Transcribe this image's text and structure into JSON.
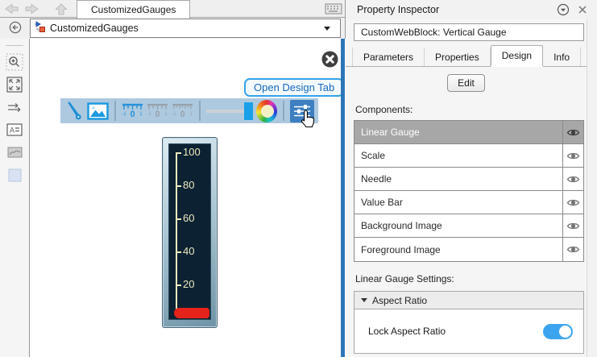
{
  "colors": {
    "accent_blue": "#1e9ae0",
    "splitter_blue": "#2e75b6",
    "toolbar_bg": "#adc9e0",
    "selected_row_gray": "#a7a7a7",
    "toggle_on_blue": "#3da5f0",
    "tooltip_text_blue": "#1669be",
    "gauge_face_navy": "#0c2233",
    "gauge_scale_cream": "#ece9bd",
    "gauge_needle_red": "#e6231b"
  },
  "tab_bar": {
    "document_tab": "CustomizedGauges",
    "icons": [
      "back-arrow-icon",
      "forward-arrow-icon",
      "up-arrow-icon",
      "keyboard-icon"
    ]
  },
  "breadcrumb": {
    "model_name": "CustomizedGauges",
    "icons": [
      "model-icon",
      "chevron-down-icon"
    ]
  },
  "sidebar": {
    "icons": [
      "hide-browser-icon",
      "zoom-icon",
      "fit-to-view-icon",
      "signal-routing-icon",
      "annotation-icon",
      "image-icon",
      "area-icon"
    ]
  },
  "canvas": {
    "close_icon": "close-icon",
    "tooltip_label": "Open Design Tab",
    "gauge_toolbar_icons": [
      "needle-icon",
      "image-icon",
      "linear-scale-blue-icon",
      "linear-scale-icon",
      "linear-scale-alt-icon",
      "slider-icon",
      "color-wheel-icon",
      "design-settings-icon",
      "hand-cursor-icon"
    ],
    "gauge": {
      "type": "vertical-linear-gauge",
      "tick_labels": [
        "100",
        "80",
        "60",
        "40",
        "20"
      ],
      "range": [
        0,
        100
      ],
      "needle_value": 0
    }
  },
  "inspector": {
    "title": "Property Inspector",
    "header_icons": [
      "collapse-panel-icon",
      "close-icon"
    ],
    "block_name": "CustomWebBlock: Vertical Gauge",
    "tabs": [
      {
        "label": "Parameters",
        "active": false
      },
      {
        "label": "Properties",
        "active": false
      },
      {
        "label": "Design",
        "active": true
      },
      {
        "label": "Info",
        "active": false
      }
    ],
    "edit_label": "Edit",
    "components_label": "Components:",
    "components": [
      {
        "name": "Linear Gauge",
        "selected": true,
        "visible": true
      },
      {
        "name": "Scale",
        "selected": false,
        "visible": true
      },
      {
        "name": "Needle",
        "selected": false,
        "visible": true
      },
      {
        "name": "Value Bar",
        "selected": false,
        "visible": true
      },
      {
        "name": "Background Image",
        "selected": false,
        "visible": true
      },
      {
        "name": "Foreground Image",
        "selected": false,
        "visible": true
      }
    ],
    "row_icon": "eye-icon",
    "settings_label": "Linear Gauge Settings:",
    "aspect_section": {
      "label": "Aspect Ratio",
      "expanded": true
    },
    "lock_row": {
      "label": "Lock Aspect Ratio",
      "toggle_on": true
    }
  }
}
